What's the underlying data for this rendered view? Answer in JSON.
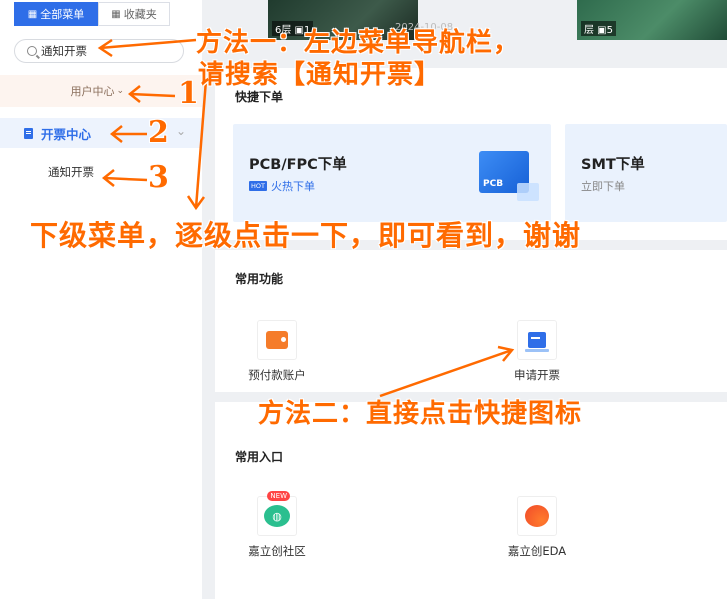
{
  "sidebar": {
    "tabs": [
      {
        "label": "全部菜单",
        "icon": "grid-icon"
      },
      {
        "label": "收藏夹",
        "icon": "grid-icon"
      }
    ],
    "search_value": "通知开票",
    "menu": {
      "user_center": "用户中心",
      "invoice_center": "开票中心",
      "sub_item": "通知开票"
    }
  },
  "main": {
    "photos": [
      {
        "tag": "6层 ▣1"
      },
      {
        "tag": "层 ▣5"
      }
    ],
    "faint_date": "2024-10-08",
    "quick_order": {
      "title": "快捷下单",
      "cards": [
        {
          "title": "PCB/FPC下单",
          "badge": "HOT",
          "subtitle": "火热下单",
          "icon_text": "PCB"
        },
        {
          "title": "SMT下单",
          "subtitle": "立即下单"
        }
      ]
    },
    "functions": {
      "title": "常用功能",
      "items": [
        {
          "label": "预付款账户",
          "icon": "wallet-icon"
        },
        {
          "label": "申请开票",
          "icon": "invoice-icon"
        }
      ]
    },
    "entries": {
      "title": "常用入口",
      "items": [
        {
          "label": "嘉立创社区",
          "icon": "community-icon",
          "badge": "NEW"
        },
        {
          "label": "嘉立创EDA",
          "icon": "eda-icon"
        }
      ]
    }
  },
  "annotations": {
    "method1_line1": "方法一：左边菜单导航栏，",
    "method1_line2": "请搜索【通知开票】",
    "step1": "1",
    "step2": "2",
    "step3": "3",
    "submenu_tip": "下级菜单，逐级点击一下，即可看到，谢谢",
    "method2": "方法二：直接点击快捷图标",
    "accent_color": "#ff6a00"
  }
}
